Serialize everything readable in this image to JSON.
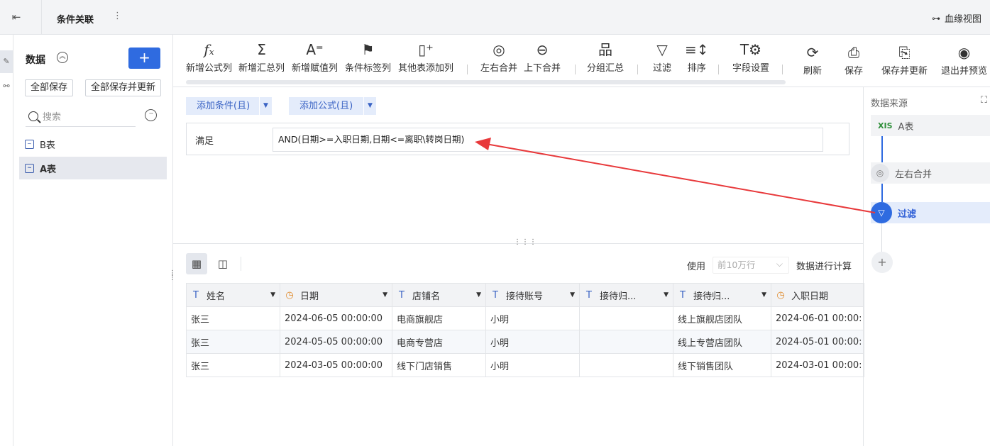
{
  "topbar": {
    "title": "条件关联",
    "more": "⋮",
    "lineage_label": "血缘视图"
  },
  "data_panel": {
    "title": "数据",
    "add_label": "+",
    "save_all": "全部保存",
    "save_all_update": "全部保存并更新",
    "search_placeholder": "搜索",
    "tables": [
      {
        "label": "B表"
      },
      {
        "label": "A表"
      }
    ]
  },
  "toolbar": {
    "items": [
      {
        "label": "新增公式列",
        "icon": "formula-icon"
      },
      {
        "label": "新增汇总列",
        "icon": "sigma-icon"
      },
      {
        "label": "新增赋值列",
        "icon": "assign-icon"
      },
      {
        "label": "条件标签列",
        "icon": "flag-icon"
      },
      {
        "label": "其他表添加列",
        "icon": "add-column-icon"
      },
      {
        "label": "左右合并",
        "icon": "venn-icon"
      },
      {
        "label": "上下合并",
        "icon": "stack-merge-icon"
      },
      {
        "label": "分组汇总",
        "icon": "group-icon"
      },
      {
        "label": "过滤",
        "icon": "filter-icon"
      },
      {
        "label": "排序",
        "icon": "sort-icon"
      },
      {
        "label": "字段设置",
        "icon": "field-settings-icon"
      },
      {
        "label": "刷新",
        "icon": "refresh-icon"
      },
      {
        "label": "保存",
        "icon": "save-icon"
      },
      {
        "label": "保存并更新",
        "icon": "save-update-icon"
      },
      {
        "label": "退出并预览",
        "icon": "preview-icon"
      }
    ]
  },
  "condition": {
    "add_condition": "添加条件(且)",
    "add_formula": "添加公式(且)",
    "satisfy_label": "满足",
    "expression": "AND(日期>=入职日期,日期<=离职\\转岗日期)"
  },
  "table_view": {
    "use_label": "使用",
    "rows_option": "前10万行",
    "calc_label": "数据进行计算",
    "columns": [
      {
        "name": "姓名",
        "type": "text"
      },
      {
        "name": "日期",
        "type": "date"
      },
      {
        "name": "店铺名",
        "type": "text"
      },
      {
        "name": "接待账号",
        "type": "text"
      },
      {
        "name": "接待归...",
        "type": "text"
      },
      {
        "name": "接待归...",
        "type": "text"
      },
      {
        "name": "入职日期",
        "type": "date"
      }
    ],
    "rows": [
      [
        "张三",
        "2024-06-05 00:00:00",
        "电商旗舰店",
        "小明",
        "",
        "线上旗舰店团队",
        "2024-06-01 00:00:"
      ],
      [
        "张三",
        "2024-05-05 00:00:00",
        "电商专营店",
        "小明",
        "",
        "线上专营店团队",
        "2024-05-01 00:00:"
      ],
      [
        "张三",
        "2024-03-05 00:00:00",
        "线下门店销售",
        "小明",
        "",
        "线下销售团队",
        "2024-03-01 00:00:"
      ]
    ]
  },
  "right_panel": {
    "title": "数据来源",
    "nodes": [
      {
        "label": "A表",
        "badge": "XIS"
      },
      {
        "label": "左右合并"
      },
      {
        "label": "过滤"
      }
    ],
    "add": "+"
  },
  "colors": {
    "accent": "#2f6be0",
    "arrow": "#e8393b"
  }
}
